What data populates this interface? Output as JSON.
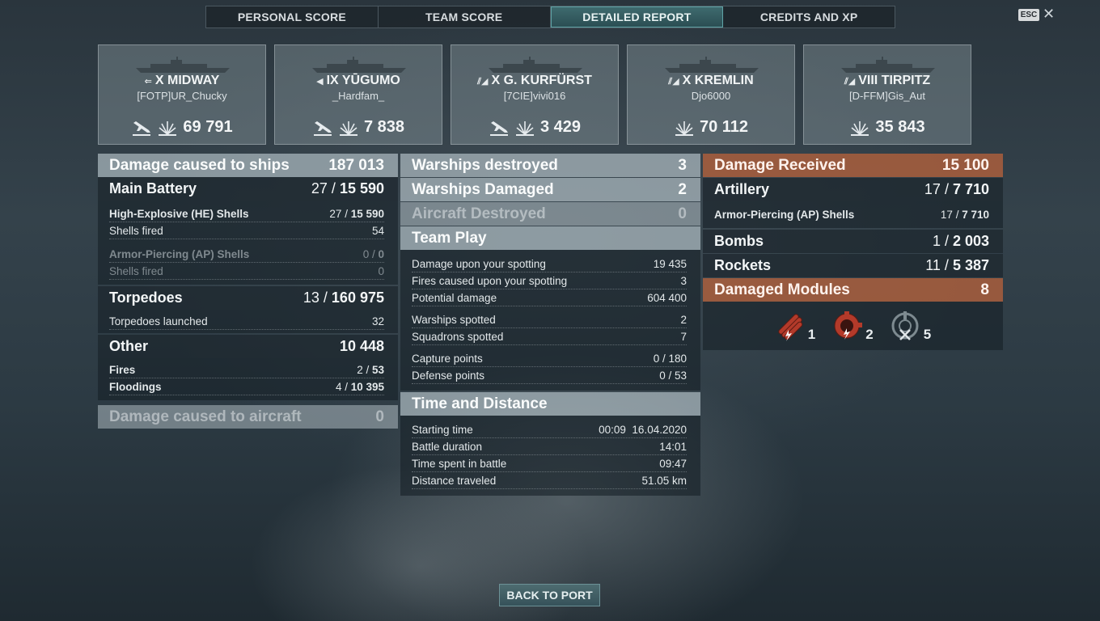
{
  "tabs": [
    "PERSONAL SCORE",
    "TEAM SCORE",
    "DETAILED REPORT",
    "CREDITS AND XP"
  ],
  "esc_label": "ESC",
  "close_glyph": "✕",
  "players": [
    {
      "tier": "X",
      "ship": "MIDWAY",
      "class_icon": "carrier-class-icon",
      "player": "[FOTP]UR_Chucky",
      "damage": "69 791",
      "plane": true
    },
    {
      "tier": "IX",
      "ship": "YŪGUMO",
      "class_icon": "destroyer-class-icon",
      "player": "_Hardfam_",
      "damage": "7 838",
      "plane": true
    },
    {
      "tier": "X",
      "ship": "G. KURFÜRST",
      "class_icon": "battleship-class-icon",
      "player": "[7CIE]vivi016",
      "damage": "3 429",
      "plane": true
    },
    {
      "tier": "X",
      "ship": "KREMLIN",
      "class_icon": "battleship-class-icon",
      "player": "Djo6000",
      "damage": "70 112",
      "plane": false
    },
    {
      "tier": "VIII",
      "ship": "TIRPITZ",
      "class_icon": "battleship-class-icon",
      "player": "[D-FFM]Gis_Aut",
      "damage": "35 843",
      "plane": false
    }
  ],
  "left": {
    "damage_ships": {
      "label": "Damage caused to ships",
      "value": "187 013"
    },
    "main_battery": {
      "label": "Main Battery",
      "hits": "27 / ",
      "dmg": "15 590"
    },
    "he": {
      "label": "High-Explosive (HE) Shells",
      "hits": "27 / ",
      "dmg": "15 590"
    },
    "he_fired": {
      "label": "Shells fired",
      "value": "54"
    },
    "ap": {
      "label": "Armor-Piercing (AP) Shells",
      "hits": "0 / ",
      "dmg": "0"
    },
    "ap_fired": {
      "label": "Shells fired",
      "value": "0"
    },
    "torpedoes": {
      "label": "Torpedoes",
      "hits": "13 / ",
      "dmg": "160 975"
    },
    "torp_launched": {
      "label": "Torpedoes launched",
      "value": "32"
    },
    "other": {
      "label": "Other",
      "value": "10 448"
    },
    "fires": {
      "label": "Fires",
      "hits": "2 / ",
      "dmg": "53"
    },
    "floodings": {
      "label": "Floodings",
      "hits": "4 / ",
      "dmg": "10 395"
    },
    "damage_aircraft": {
      "label": "Damage caused to aircraft",
      "value": "0"
    }
  },
  "middle": {
    "destroyed": {
      "label": "Warships destroyed",
      "value": "3"
    },
    "damaged": {
      "label": "Warships Damaged",
      "value": "2"
    },
    "aircraft": {
      "label": "Aircraft Destroyed",
      "value": "0"
    },
    "teamplay_title": "Team Play",
    "spot_dmg": {
      "label": "Damage upon your spotting",
      "value": "19 435"
    },
    "spot_fires": {
      "label": "Fires caused upon your spotting",
      "value": "3"
    },
    "potential": {
      "label": "Potential damage",
      "value": "604 400"
    },
    "ships_spotted": {
      "label": "Warships spotted",
      "value": "2"
    },
    "squad_spotted": {
      "label": "Squadrons spotted",
      "value": "7"
    },
    "capture": {
      "label": "Capture points",
      "value": "0 / 180"
    },
    "defense": {
      "label": "Defense points",
      "value": "0 / 53"
    },
    "time_title": "Time and Distance",
    "start": {
      "label": "Starting time",
      "value": "00:09  16.04.2020"
    },
    "duration": {
      "label": "Battle duration",
      "value": "14:01"
    },
    "spent": {
      "label": "Time spent in battle",
      "value": "09:47"
    },
    "distance": {
      "label": "Distance traveled",
      "value": "51.05 km"
    }
  },
  "right": {
    "received": {
      "label": "Damage Received",
      "value": "15 100"
    },
    "artillery": {
      "label": "Artillery",
      "hits": "17 / ",
      "dmg": "7 710"
    },
    "ap": {
      "label": "Armor-Piercing (AP) Shells",
      "hits": "17 / ",
      "dmg": "7 710"
    },
    "bombs": {
      "label": "Bombs",
      "hits": "1 / ",
      "dmg": "2 003"
    },
    "rockets": {
      "label": "Rockets",
      "hits": "11 / ",
      "dmg": "5 387"
    },
    "modules": {
      "label": "Damaged Modules",
      "value": "8"
    },
    "module_counts": [
      "1",
      "2",
      "5"
    ]
  },
  "back_label": "BACK TO PORT",
  "colors": {
    "accent": "#3e6a6e",
    "received": "#b2603c",
    "module_red": "#c0392b"
  }
}
